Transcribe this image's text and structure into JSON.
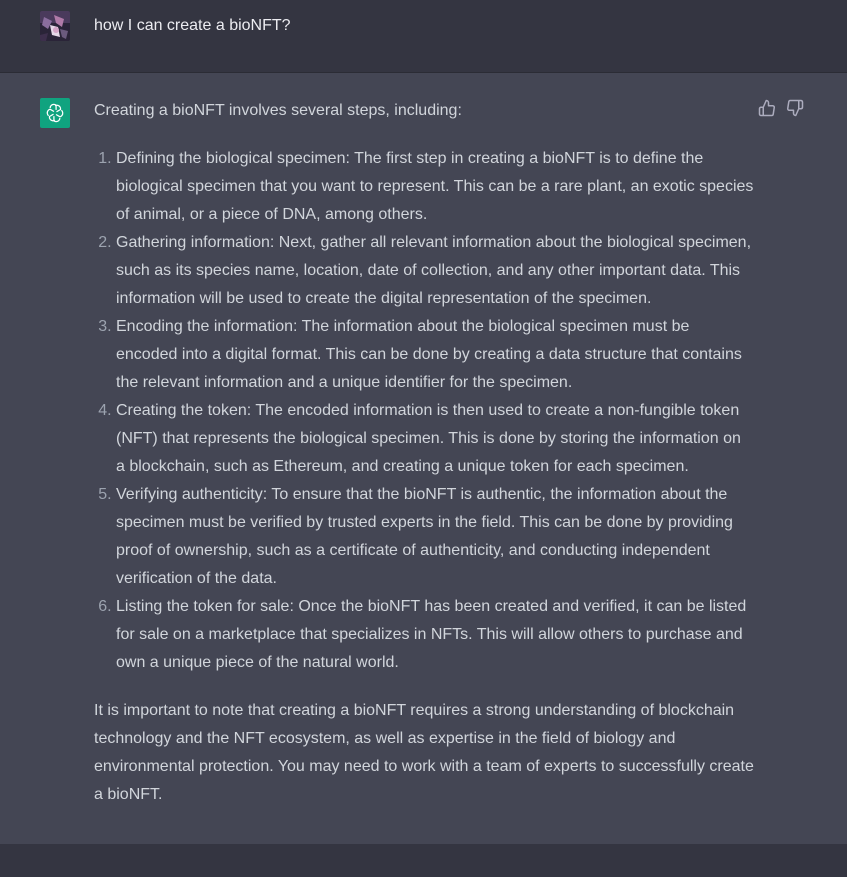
{
  "user_message": {
    "text": "how I can create a bioNFT?"
  },
  "assistant_message": {
    "intro": "Creating a bioNFT involves several steps, including:",
    "steps": [
      "Defining the biological specimen: The first step in creating a bioNFT is to define the biological specimen that you want to represent. This can be a rare plant, an exotic species of animal, or a piece of DNA, among others.",
      "Gathering information: Next, gather all relevant information about the biological specimen, such as its species name, location, date of collection, and any other important data. This information will be used to create the digital representation of the specimen.",
      "Encoding the information: The information about the biological specimen must be encoded into a digital format. This can be done by creating a data structure that contains the relevant information and a unique identifier for the specimen.",
      "Creating the token: The encoded information is then used to create a non-fungible token (NFT) that represents the biological specimen. This is done by storing the information on a blockchain, such as Ethereum, and creating a unique token for each specimen.",
      "Verifying authenticity: To ensure that the bioNFT is authentic, the information about the specimen must be verified by trusted experts in the field. This can be done by providing proof of ownership, such as a certificate of authenticity, and conducting independent verification of the data.",
      "Listing the token for sale: Once the bioNFT has been created and verified, it can be listed for sale on a marketplace that specializes in NFTs. This will allow others to purchase and own a unique piece of the natural world."
    ],
    "outro": "It is important to note that creating a bioNFT requires a strong understanding of blockchain technology and the NFT ecosystem, as well as expertise in the field of biology and environmental protection. You may need to work with a team of experts to successfully create a bioNFT."
  },
  "icons": {
    "user_avatar": "user-avatar-image",
    "bot_avatar": "openai-logo-icon",
    "thumbs_up": "thumbs-up-icon",
    "thumbs_down": "thumbs-down-icon"
  },
  "colors": {
    "background": "#343541",
    "assistant_background": "#444654",
    "bot_avatar": "#10a37f",
    "text": "#d1d5db",
    "user_text": "#ececf1"
  }
}
